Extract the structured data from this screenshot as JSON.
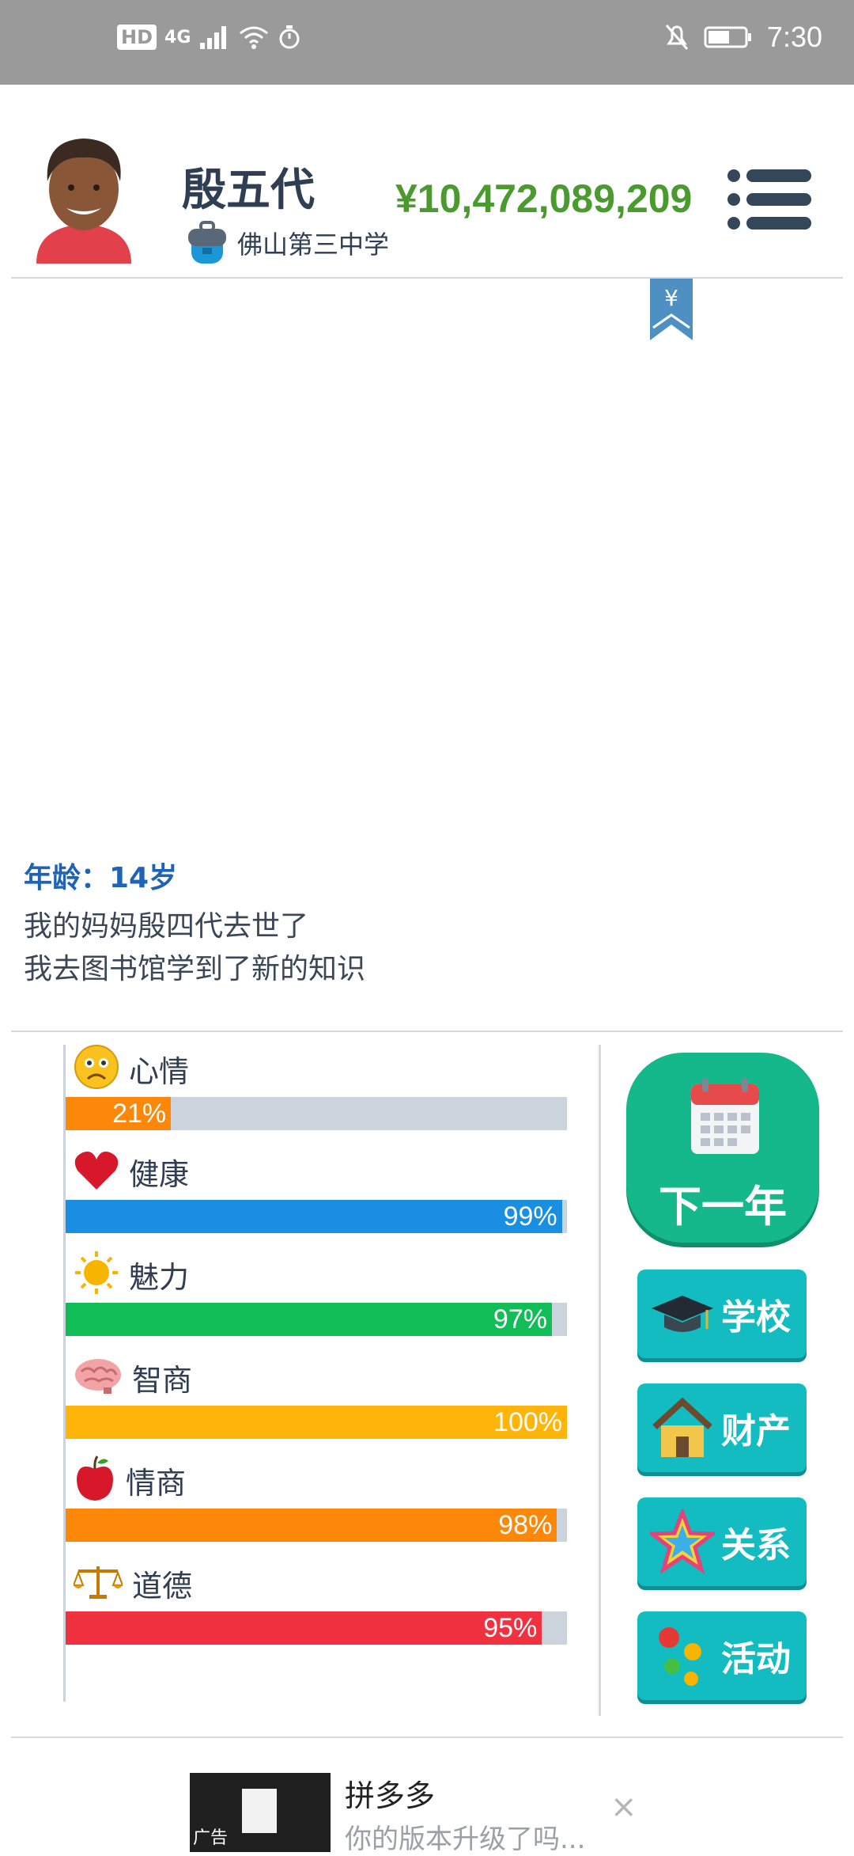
{
  "status_bar": {
    "left_indicators": [
      "HD",
      "4G"
    ],
    "time": "7:30"
  },
  "header": {
    "name": "殷五代",
    "school": "佛山第三中学",
    "money": "¥10,472,089,209"
  },
  "log": {
    "age": "年龄：14岁",
    "lines": [
      "我的妈妈殷四代去世了",
      "我去图书馆学到了新的知识"
    ]
  },
  "stats": [
    {
      "label": "心情",
      "percent": 21,
      "text": "21%",
      "color": "#fd8708",
      "icon": "sad-face-icon"
    },
    {
      "label": "健康",
      "percent": 99,
      "text": "99%",
      "color": "#1a8ee0",
      "icon": "heart-icon"
    },
    {
      "label": "魅力",
      "percent": 97,
      "text": "97%",
      "color": "#11bd57",
      "icon": "sun-icon"
    },
    {
      "label": "智商",
      "percent": 100,
      "text": "100%",
      "color": "#ffb40a",
      "icon": "brain-icon"
    },
    {
      "label": "情商",
      "percent": 98,
      "text": "98%",
      "color": "#fd8708",
      "icon": "apple-icon"
    },
    {
      "label": "道德",
      "percent": 95,
      "text": "95%",
      "color": "#f0313f",
      "icon": "scales-icon"
    }
  ],
  "actions": {
    "next_year": "下一年",
    "school": "学校",
    "property": "财产",
    "relations": "关系",
    "activities": "活动"
  },
  "ad": {
    "tag": "广告",
    "title": "拼多多",
    "subtitle": "你的版本升级了吗...",
    "close": "×"
  },
  "colors": {
    "money": "#4b9a2f",
    "age": "#1e63b5",
    "next_year_bg": "#15b88a",
    "side_button_bg": "#12bcc0",
    "bar_track": "#cbd3dd"
  }
}
